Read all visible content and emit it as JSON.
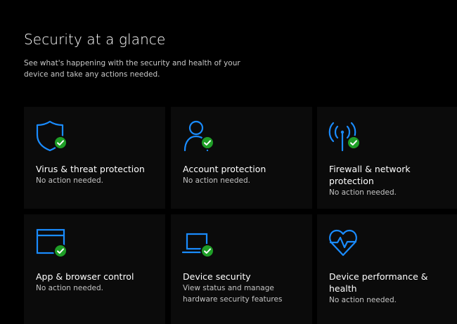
{
  "header": {
    "title": "Security at a glance",
    "subtitle": "See what's happening with the security and health of your device and take any actions needed."
  },
  "colors": {
    "accent": "#1a8cff",
    "status_ok": "#1f9e27",
    "background": "#000000",
    "tile": "#0b0b0b"
  },
  "tiles": [
    {
      "icon": "shield-icon",
      "title": "Virus & threat protection",
      "status": "No action needed.",
      "ok": true
    },
    {
      "icon": "person-icon",
      "title": "Account protection",
      "status": "No action needed.",
      "ok": true
    },
    {
      "icon": "wireless-antenna-icon",
      "title": "Firewall & network protection",
      "status": "No action needed.",
      "ok": true
    },
    {
      "icon": "browser-window-icon",
      "title": "App & browser control",
      "status": "No action needed.",
      "ok": true
    },
    {
      "icon": "laptop-icon",
      "title": "Device security",
      "status": "View status and manage hardware security features",
      "ok": true
    },
    {
      "icon": "heart-pulse-icon",
      "title": "Device performance & health",
      "status": "No action needed.",
      "ok": false
    }
  ]
}
